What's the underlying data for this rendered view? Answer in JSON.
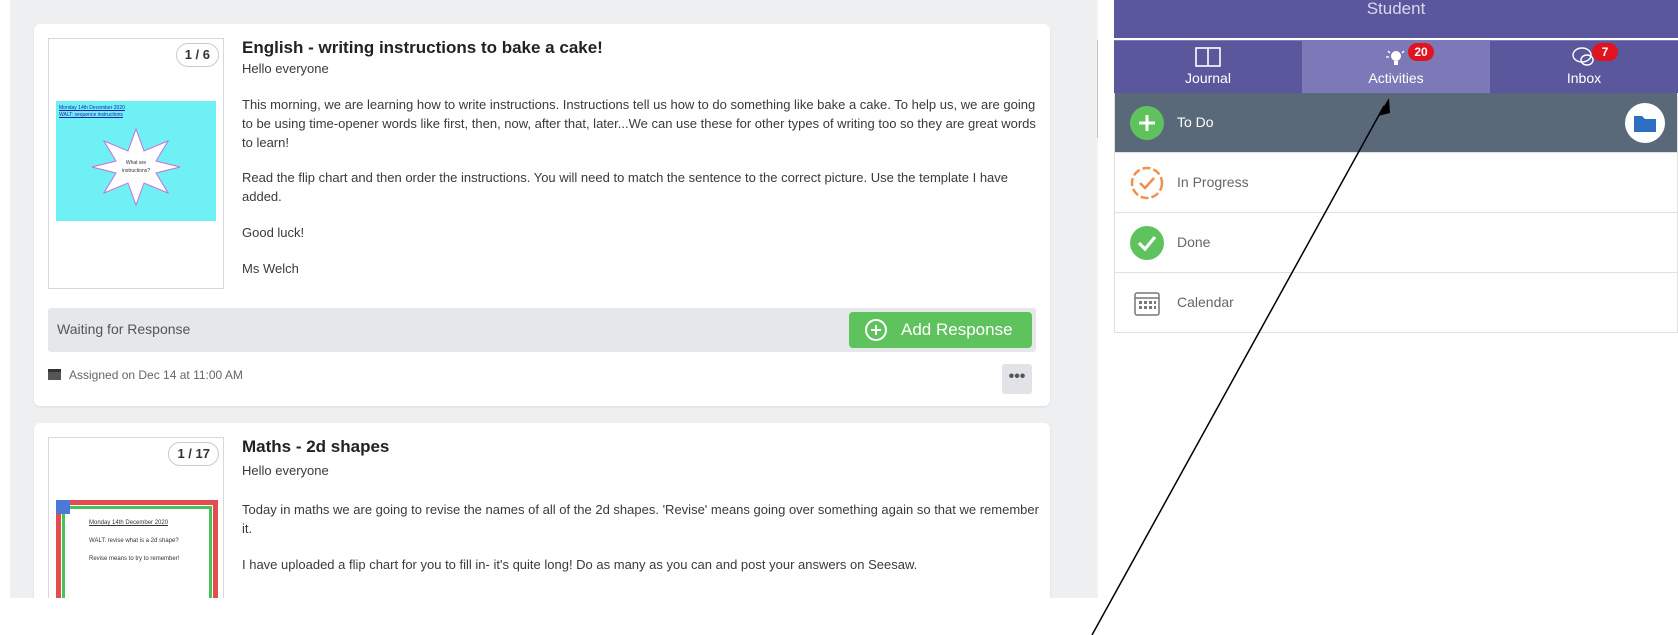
{
  "feed": {
    "posts": [
      {
        "page_indicator": "1 / 6",
        "title": "English - writing instructions to bake a cake!",
        "greeting": "Hello everyone",
        "paragraphs": [
          "This morning, we are learning how to write instructions. Instructions tell us how to do something like bake a cake. To help us, we are going to be using time-opener words like first, then, now, after that, later...We can use these for other types of writing too so they are great words to learn!",
          "Read the flip chart and then order the instructions. You will need to match the sentence to the correct picture. Use the template I have added.",
          "Good luck!",
          "Ms Welch"
        ],
        "thumb_text": [
          "Monday 14th December 2020",
          "WALT: sequence instructions",
          "What are instructions?"
        ],
        "status": "Waiting for Response",
        "action_label": "Add Response",
        "assigned": "Assigned on Dec 14 at 11:00 AM",
        "more_label": "•••"
      },
      {
        "page_indicator": "1 / 17",
        "title": "Maths - 2d shapes",
        "greeting": "Hello everyone",
        "paragraphs": [
          "Today in maths we are going to revise the names of all of the 2d shapes. 'Revise' means going over something again so that we remember it.",
          "I have uploaded a flip chart for you to fill in- it's quite long! Do as many as you can and post your answers on Seesaw."
        ],
        "thumb_text": [
          "Monday 14th December 2020",
          "WALT: revise what is a 2d shape?",
          "Revise means to try to remember!"
        ]
      }
    ]
  },
  "panel": {
    "role": "Student",
    "tabs": [
      {
        "label": "Journal",
        "icon": "journal-book-icon"
      },
      {
        "label": "Activities",
        "icon": "lightbulb-icon",
        "badge": "20"
      },
      {
        "label": "Inbox",
        "icon": "chat-bubbles-icon",
        "badge": "7"
      }
    ],
    "active_tab": "Activities",
    "filters": [
      {
        "label": "To Do",
        "icon": "plus-circle-icon"
      },
      {
        "label": "In Progress",
        "icon": "dashed-check-icon"
      },
      {
        "label": "Done",
        "icon": "check-circle-icon"
      },
      {
        "label": "Calendar",
        "icon": "calendar-icon"
      }
    ],
    "active_filter": "To Do"
  },
  "colors": {
    "header_purple": "#5b579c",
    "active_tab": "#7d79b8",
    "badge_red": "#e0141e",
    "green": "#5ec25d",
    "active_row": "#5a6979",
    "orange": "#f0904a"
  }
}
